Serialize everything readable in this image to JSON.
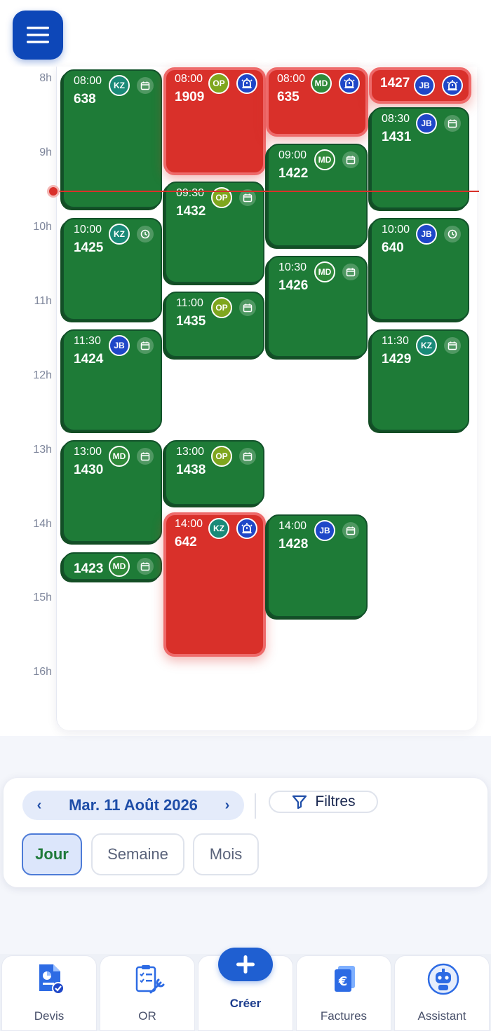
{
  "hours": [
    "8h",
    "9h",
    "10h",
    "11h",
    "12h",
    "13h",
    "14h",
    "15h",
    "16h"
  ],
  "colors": {
    "event_green": "#1e7b37",
    "event_red": "#d9302a",
    "now_line": "#d9302a",
    "primary": "#0d47b8",
    "date_text": "#1f4ea8",
    "active_view_text": "#1f7a3a"
  },
  "avatars": {
    "KZ": "#1a8a78",
    "OP": "#7fa61e",
    "MD": "#2f8a3a",
    "JB": "#1f47c8"
  },
  "events": [
    {
      "time": "08:00",
      "number": "638",
      "avatar": "KZ",
      "icon": "calendar-icon",
      "status": "green"
    },
    {
      "time": "10:00",
      "number": "1425",
      "avatar": "KZ",
      "icon": "clock-icon",
      "status": "green"
    },
    {
      "time": "11:30",
      "number": "1424",
      "avatar": "JB",
      "icon": "calendar-icon",
      "status": "green"
    },
    {
      "time": "13:00",
      "number": "1430",
      "avatar": "MD",
      "icon": "calendar-icon",
      "status": "green"
    },
    {
      "time": "",
      "number": "1423",
      "avatar": "MD",
      "icon": "calendar-icon",
      "status": "green"
    },
    {
      "time": "08:00",
      "number": "1909",
      "avatar": "OP",
      "icon": "alarm-icon",
      "status": "red"
    },
    {
      "time": "09:30",
      "number": "1432",
      "avatar": "OP",
      "icon": "calendar-icon",
      "status": "green"
    },
    {
      "time": "11:00",
      "number": "1435",
      "avatar": "OP",
      "icon": "calendar-icon",
      "status": "green"
    },
    {
      "time": "13:00",
      "number": "1438",
      "avatar": "OP",
      "icon": "calendar-icon",
      "status": "green"
    },
    {
      "time": "14:00",
      "number": "642",
      "avatar": "KZ",
      "icon": "alarm-icon",
      "status": "red"
    },
    {
      "time": "08:00",
      "number": "635",
      "avatar": "MD",
      "icon": "alarm-icon",
      "status": "red"
    },
    {
      "time": "09:00",
      "number": "1422",
      "avatar": "MD",
      "icon": "calendar-icon",
      "status": "green"
    },
    {
      "time": "10:30",
      "number": "1426",
      "avatar": "MD",
      "icon": "calendar-icon",
      "status": "green"
    },
    {
      "time": "14:00",
      "number": "1428",
      "avatar": "JB",
      "icon": "calendar-icon",
      "status": "green"
    },
    {
      "time": "",
      "number": "1427",
      "avatar": "JB",
      "icon": "alarm-icon",
      "status": "red"
    },
    {
      "time": "08:30",
      "number": "1431",
      "avatar": "JB",
      "icon": "calendar-icon",
      "status": "green"
    },
    {
      "time": "10:00",
      "number": "640",
      "avatar": "JB",
      "icon": "clock-icon",
      "status": "green"
    },
    {
      "time": "11:30",
      "number": "1429",
      "avatar": "KZ",
      "icon": "calendar-icon",
      "status": "green"
    }
  ],
  "controls": {
    "date": "Mar. 11 Août 2026",
    "prev": "‹",
    "next": "›",
    "filter_label": "Filtres",
    "views": [
      "Jour",
      "Semaine",
      "Mois"
    ],
    "active_view": "Jour"
  },
  "nav": {
    "items": [
      {
        "label": "Devis",
        "icon": "quote-document-icon"
      },
      {
        "label": "OR",
        "icon": "clipboard-wrench-icon"
      },
      {
        "label": "Factures",
        "icon": "invoice-euro-icon"
      },
      {
        "label": "Assistant",
        "icon": "robot-assistant-icon"
      }
    ],
    "create_label": "Créer"
  }
}
